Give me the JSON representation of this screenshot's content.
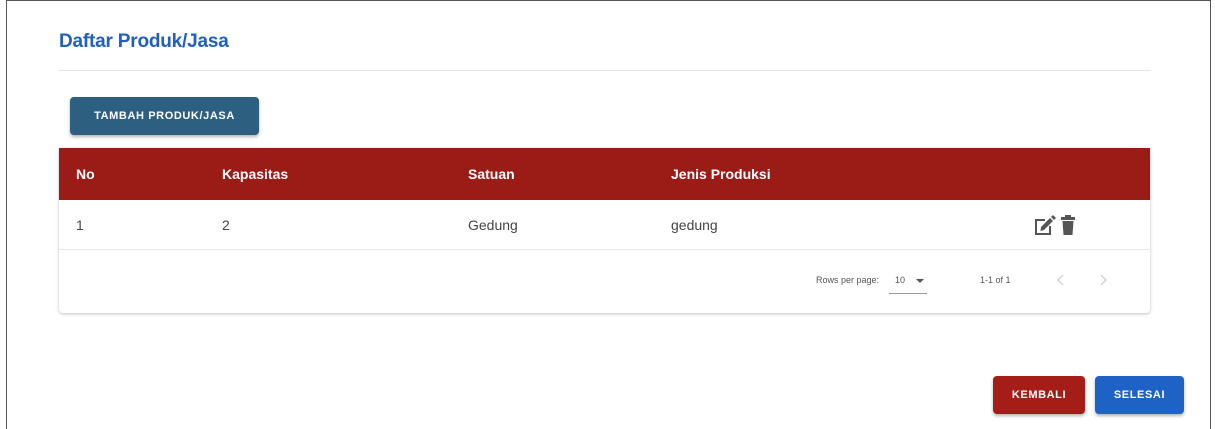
{
  "header": {
    "title": "Daftar Produk/Jasa"
  },
  "toolbar": {
    "add_label": "TAMBAH PRODUK/JASA"
  },
  "table": {
    "columns": [
      "No",
      "Kapasitas",
      "Satuan",
      "Jenis Produksi"
    ],
    "rows": [
      {
        "no": "1",
        "kapasitas": "2",
        "satuan": "Gedung",
        "jenis_produksi": "gedung"
      }
    ],
    "actions": {
      "edit_icon": "edit-icon",
      "delete_icon": "trash-icon"
    }
  },
  "pagination": {
    "rows_per_page_label": "Rows per page:",
    "rows_per_page_value": "10",
    "range_text": "1-1 of 1"
  },
  "footer_actions": {
    "back_label": "KEMBALI",
    "done_label": "SELESAI"
  },
  "colors": {
    "title": "#1f5fbf",
    "table_header": "#9b1c17",
    "add_button": "#2c5f80",
    "back_button": "#a51d17",
    "done_button": "#1d62c4"
  }
}
